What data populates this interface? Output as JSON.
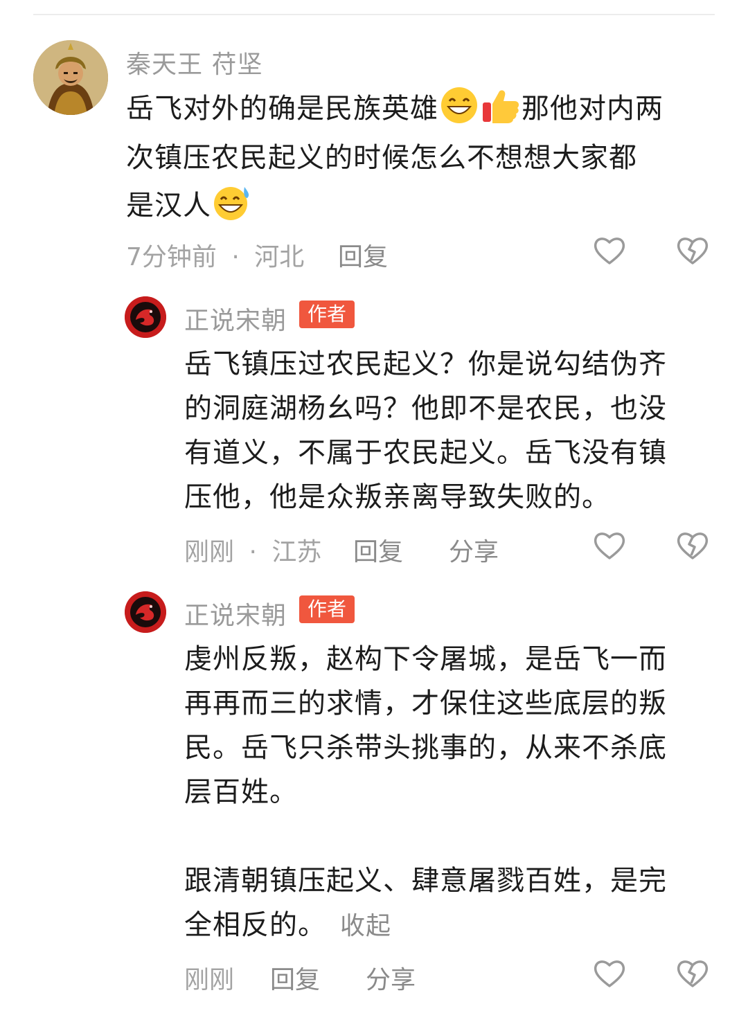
{
  "comment1": {
    "username": "秦天王 苻坚",
    "text_line1_a": "岳飞对外的确是民族英雄",
    "text_line1_b": "那他对内两",
    "text_line2": "次镇压农民起义的时候怎么不想想大家都",
    "text_line3": "是汉人",
    "emoji1": "grinning-face-icon",
    "emoji2": "thumbs-up-icon",
    "emoji3": "grinning-sweat-icon",
    "time": "7分钟前",
    "sep": "·",
    "location": "河北",
    "reply_label": "回复"
  },
  "reply1": {
    "username": "正说宋朝",
    "badge": "作者",
    "lines": [
      "岳飞镇压过农民起义？你是说勾结伪齐",
      "的洞庭湖杨幺吗？他即不是农民，也没",
      "有道义，不属于农民起义。岳飞没有镇",
      "压他，他是众叛亲离导致失败的。"
    ],
    "time": "刚刚",
    "sep": "·",
    "location": "江苏",
    "reply_label": "回复",
    "share_label": "分享"
  },
  "reply2": {
    "username": "正说宋朝",
    "badge": "作者",
    "lines": [
      "虔州反叛，赵构下令屠城，是岳飞一而",
      "再再而三的求情，才保住这些底层的叛",
      "民。岳飞只杀带头挑事的，从来不杀底",
      "层百姓。",
      "",
      "跟清朝镇压起义、肆意屠戮百姓，是完"
    ],
    "last_line": "全相反的。",
    "collapse_label": "收起",
    "time": "刚刚",
    "reply_label": "回复",
    "share_label": "分享"
  },
  "colors": {
    "badge": "#f0573e",
    "meta": "#a3a3a3",
    "icon": "#9a9a9a"
  }
}
